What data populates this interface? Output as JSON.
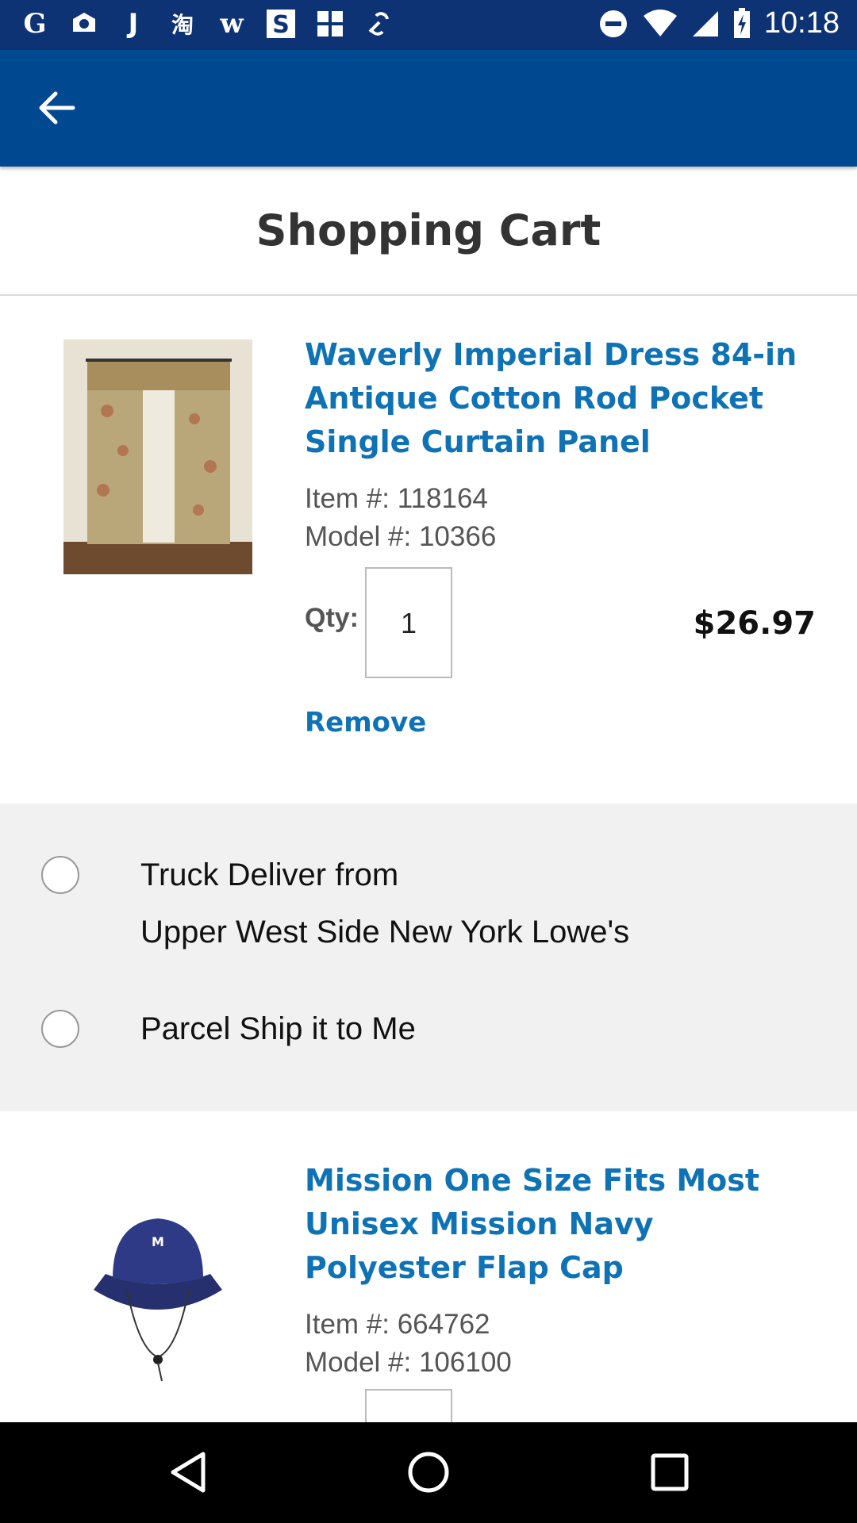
{
  "status_bar": {
    "left_icons": [
      "google-icon",
      "camera-icon",
      "j-icon",
      "taobao-icon",
      "w-icon",
      "s-icon",
      "grid-icon",
      "link-icon"
    ],
    "time": "10:18",
    "right_icons": [
      "do-not-disturb-icon",
      "wifi-icon",
      "signal-icon",
      "battery-icon"
    ]
  },
  "header": {
    "back_icon": "arrow-left-icon",
    "title": "Shopping Cart"
  },
  "items": [
    {
      "name": "Waverly Imperial Dress 84-in Antique Cotton Rod Pocket Single Curtain Panel",
      "item_number": "Item #: 118164",
      "model_number": "Model #: 10366",
      "qty_label": "Qty:",
      "qty": "1",
      "price": "$26.97",
      "remove_label": "Remove",
      "image": "curtain-panel-image"
    },
    {
      "name": "Mission One Size Fits Most Unisex Mission Navy Polyester Flap Cap",
      "item_number": "Item #: 664762",
      "model_number": "Model #: 106100",
      "image": "navy-bucket-hat-image"
    }
  ],
  "delivery_options": [
    {
      "line1": "Truck Deliver from",
      "line2": "Upper West Side New York Lowe's"
    },
    {
      "line1": "Parcel Ship it to Me"
    }
  ],
  "nav_bar": {
    "icons": [
      "back-triangle-icon",
      "home-circle-icon",
      "recents-square-icon"
    ]
  },
  "colors": {
    "status_bar": "#0d3375",
    "app_bar": "#004990",
    "link_blue": "#0f72b5",
    "delivery_bg": "#f1f1f1"
  }
}
